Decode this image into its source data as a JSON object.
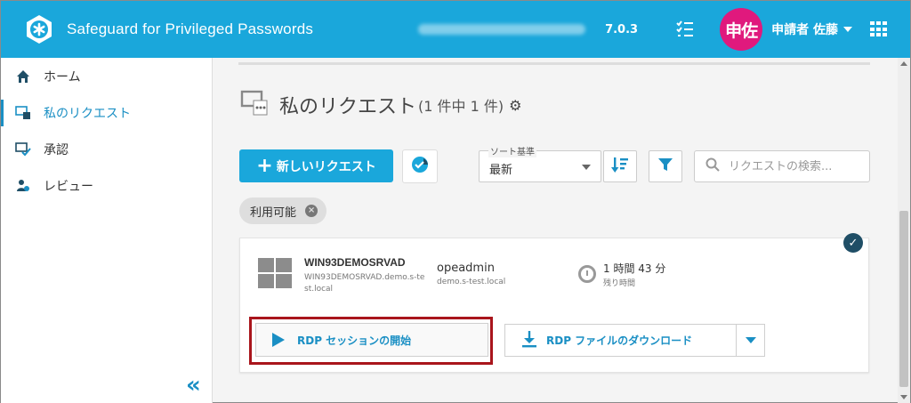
{
  "header": {
    "app_title": "Safeguard for Privileged Passwords",
    "version": "7.0.3",
    "avatar_text": "申佐",
    "user_name": "申請者 佐藤",
    "brand_color": "#1aa7db",
    "avatar_color": "#e0197d",
    "logo_icon": "asterisk-hexagon-icon",
    "tasks_icon": "task-list-icon",
    "apps_icon": "apps-grid-icon"
  },
  "sidebar": {
    "items": [
      {
        "label": "ホーム",
        "icon": "home-icon"
      },
      {
        "label": "私のリクエスト",
        "icon": "my-requests-icon",
        "active": true
      },
      {
        "label": "承認",
        "icon": "approvals-icon"
      },
      {
        "label": "レビュー",
        "icon": "review-icon"
      }
    ],
    "collapse_label": "«"
  },
  "main": {
    "title": "私のリクエスト",
    "count": "(1 件中 1 件)",
    "new_request_label": "新しいリクエスト",
    "sort": {
      "label": "ソート基準",
      "value": "最新"
    },
    "search": {
      "placeholder": "リクエストの検索..."
    },
    "filter_chip": "利用可能"
  },
  "request": {
    "asset_name": "WIN93DEMOSRVAD",
    "asset_domain": "WIN93DEMOSRVAD.demo.s-test.local",
    "account_name": "opeadmin",
    "account_domain": "demo.s-test.local",
    "time_value": "1 時間 43 分",
    "time_label": "残り時間",
    "rdp_start_label": "RDP セッションの開始",
    "rdp_download_label": "RDP ファイルのダウンロード",
    "highlight_color": "#a9151c"
  }
}
